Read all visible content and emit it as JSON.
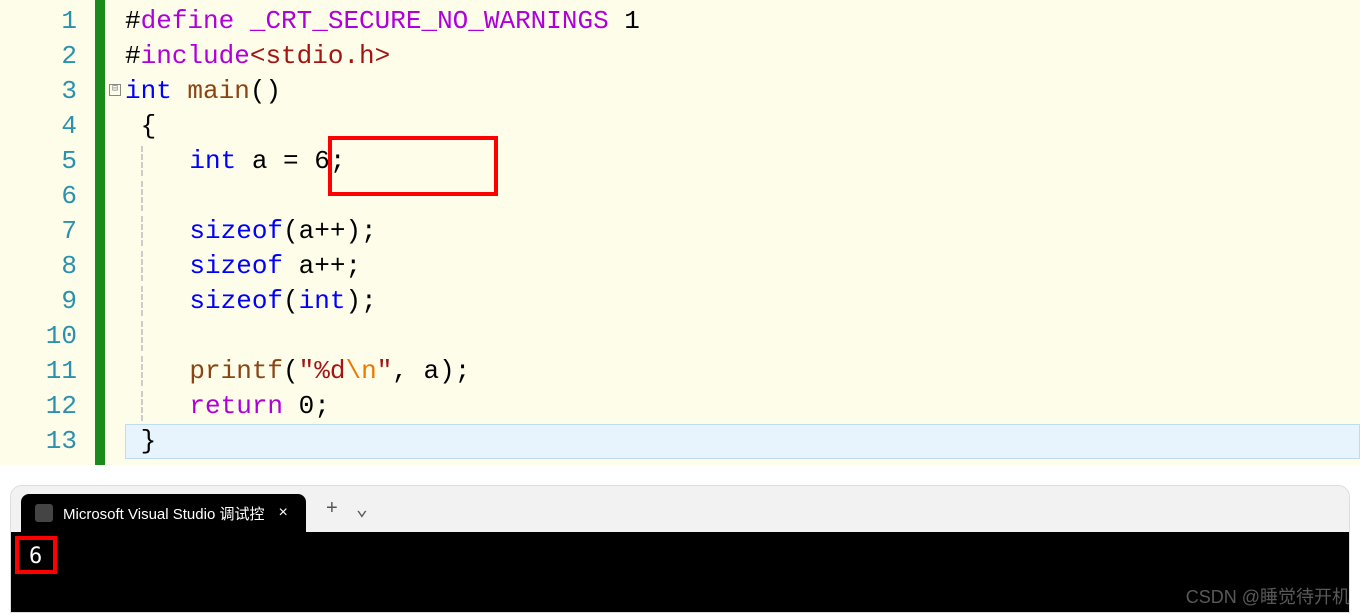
{
  "gutter": {
    "lines": [
      "1",
      "2",
      "3",
      "4",
      "5",
      "6",
      "7",
      "8",
      "9",
      "10",
      "11",
      "12",
      "13"
    ]
  },
  "fold": {
    "line3": "⊟"
  },
  "code": {
    "l1": {
      "hash": "#",
      "define": "define",
      "macro": " _CRT_SECURE_NO_WARNINGS",
      "val": " 1"
    },
    "l2": {
      "hash": "#",
      "include": "include",
      "lt": "<",
      "hdr": "stdio.h",
      "gt": ">"
    },
    "l3": {
      "int": "int",
      "sp": " ",
      "main": "main",
      "paren": "()"
    },
    "l4": {
      "brace": "{"
    },
    "l5": {
      "int": "int",
      "rest": " a = 6;"
    },
    "l6": {
      "blank": ""
    },
    "l7": {
      "sizeof": "sizeof",
      "rest": "(a++);"
    },
    "l8": {
      "sizeof": "sizeof",
      "rest": " a++;"
    },
    "l9": {
      "sizeof": "sizeof",
      "lp": "(",
      "int": "int",
      "rp": ");"
    },
    "l10": {
      "blank": ""
    },
    "l11": {
      "printf": "printf",
      "lp": "(",
      "fmt": "\"%d",
      "esc": "\\n",
      "fmtend": "\"",
      "rest": ", a);"
    },
    "l12": {
      "return": "return",
      "rest": " 0;"
    },
    "l13": {
      "brace": "}"
    }
  },
  "terminal": {
    "tab_title": "Microsoft Visual Studio 调试控",
    "output": "6",
    "plus": "+",
    "chevron": "⌄"
  },
  "watermark": "CSDN @睡觉待开机"
}
